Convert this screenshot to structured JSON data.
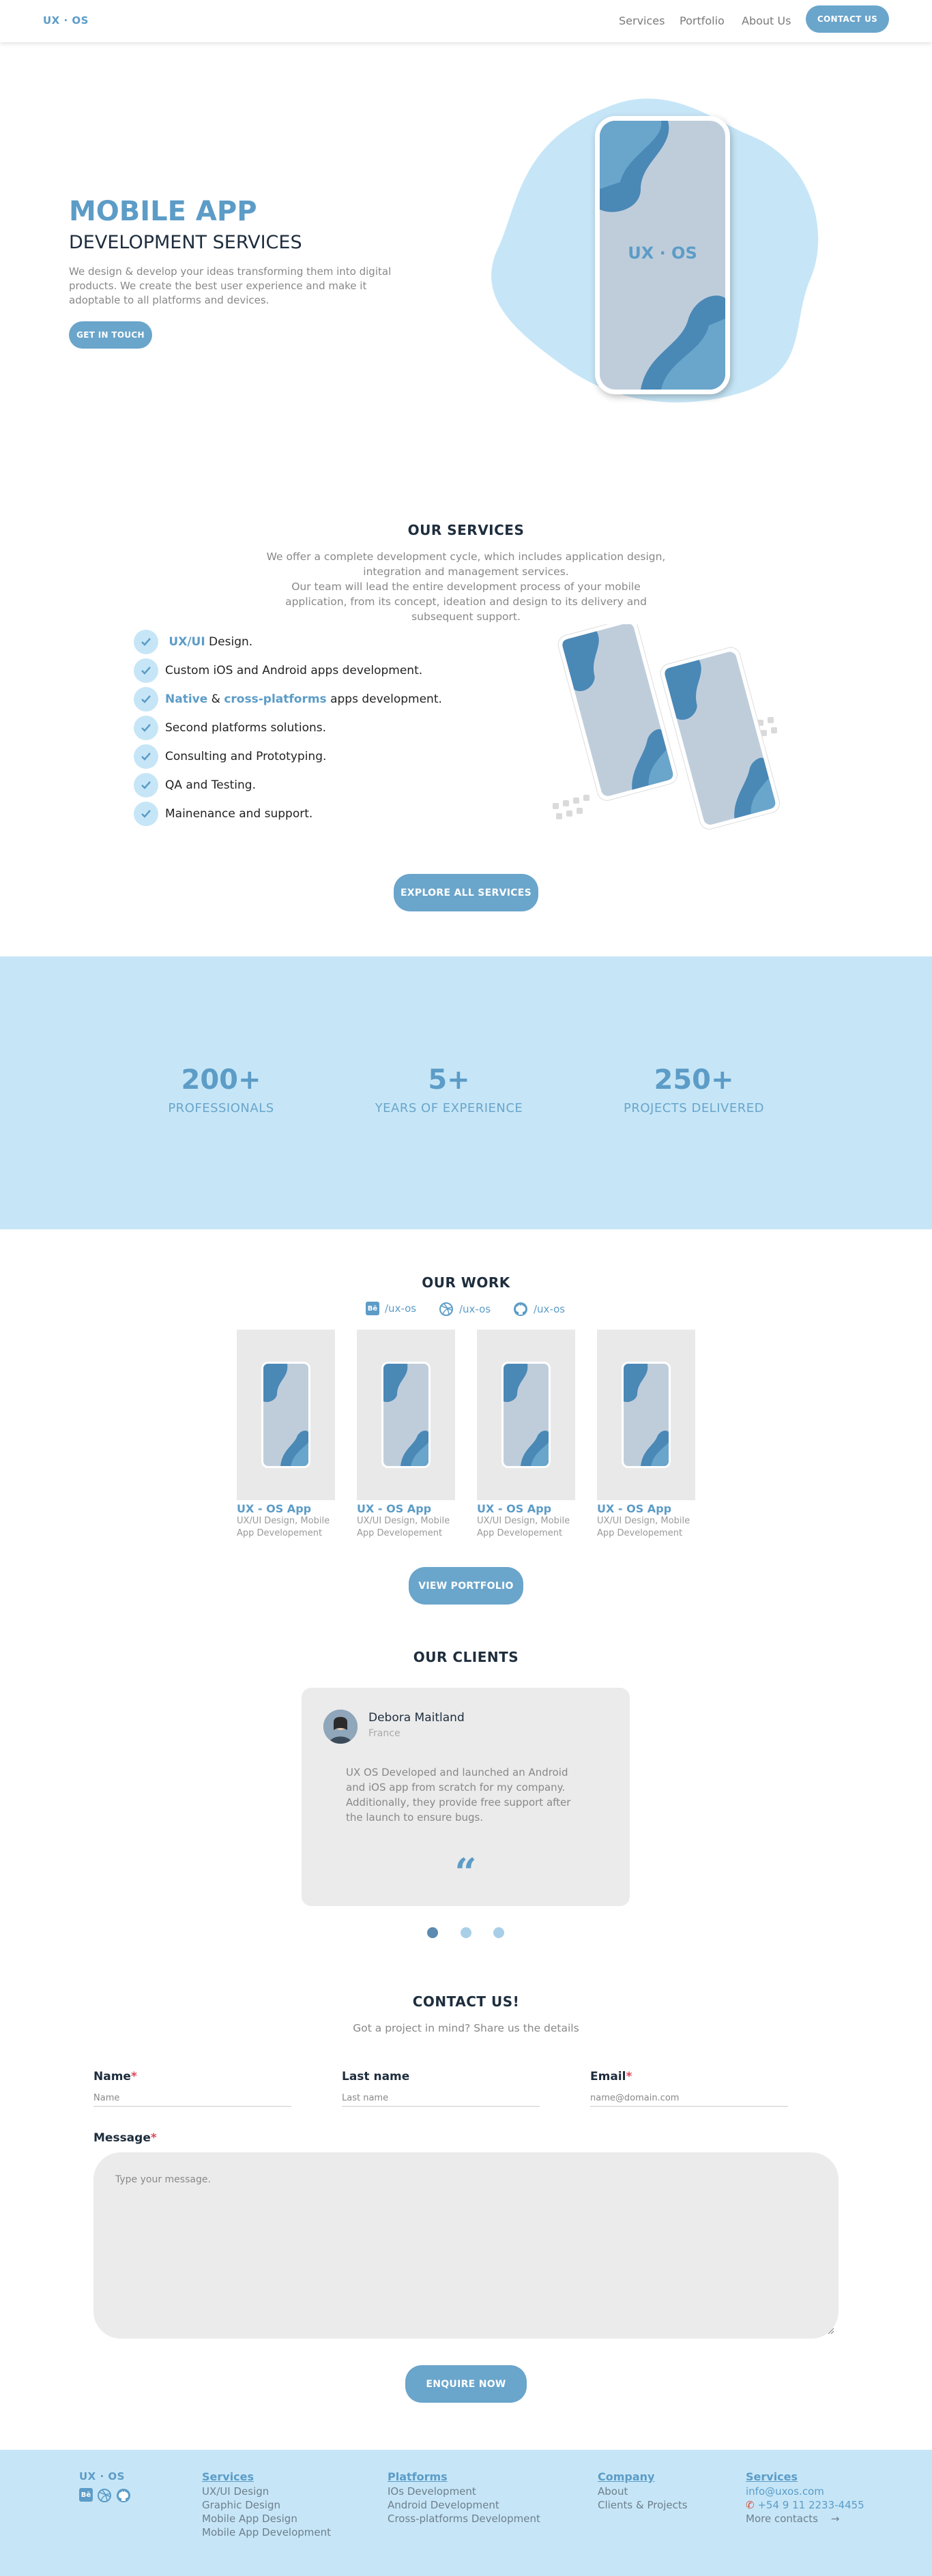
{
  "nav": {
    "logo": "UX · OS",
    "links": [
      "Services",
      "Portfolio",
      "About Us"
    ],
    "cta": "CONTACT US"
  },
  "hero": {
    "title": "MOBILE APP",
    "subtitle": "DEVELOPMENT SERVICES",
    "description": "We design & develop your ideas transforming them into digital products. We create the best user experience and make it adoptable to all platforms and devices.",
    "cta": "GET IN TOUCH",
    "phone_label": "UX · OS"
  },
  "services": {
    "title": "OUR SERVICES",
    "intro_1": "We offer a complete development cycle, which includes application design, integration and management services.",
    "intro_2": "Our team will lead the entire development process of your mobile application, from its concept, ideation and design to its delivery and subsequent support.",
    "items": [
      {
        "hl": "UX/UI",
        "text": " Design."
      },
      {
        "text": "Custom iOS and Android apps development."
      },
      {
        "hl": "Native",
        "mid": " & ",
        "hl2": "cross-platforms",
        "text": " apps development."
      },
      {
        "text": "Second platforms solutions."
      },
      {
        "text": "Consulting and Prototyping."
      },
      {
        "text": "QA and Testing."
      },
      {
        "text": "Mainenance and support."
      }
    ],
    "cta": "EXPLORE ALL SERVICES"
  },
  "stats": [
    {
      "value": "200+",
      "label": "PROFESSIONALS"
    },
    {
      "value": "5+",
      "label": "YEARS OF EXPERIENCE"
    },
    {
      "value": "250+",
      "label": "PROJECTS DELIVERED"
    }
  ],
  "work": {
    "title": "OUR WORK",
    "socials": [
      "/ux-os",
      "/ux-os",
      "/ux-os"
    ],
    "cards": [
      {
        "title": "UX - OS App",
        "sub": "UX/UI Design, Mobile App Developement"
      },
      {
        "title": "UX - OS App",
        "sub": "UX/UI Design, Mobile App Developement"
      },
      {
        "title": "UX - OS App",
        "sub": "UX/UI Design, Mobile App Developement"
      },
      {
        "title": "UX - OS App",
        "sub": "UX/UI Design, Mobile App Developement"
      }
    ],
    "cta": "VIEW PORTFOLIO"
  },
  "clients": {
    "title": "OUR CLIENTS",
    "name": "Debora Maitland",
    "country": "France",
    "quote": "UX OS Developed and launched an Android and iOS app from scratch for my company. Additionally, they provide free support after the launch to ensure bugs.",
    "quote_mark": "“"
  },
  "contact": {
    "title": "CONTACT US!",
    "subtitle": "Got a project in mind? Share us the details",
    "name_label": "Name",
    "name_ph": "Name",
    "last_label": "Last name",
    "last_ph": "Last name",
    "email_label": "Email",
    "email_ph": "name@domain.com",
    "message_label": "Message",
    "message_ph": "Type your message.",
    "required_mark": "*",
    "cta": "ENQUIRE NOW"
  },
  "footer": {
    "logo": "UX · OS",
    "col1": {
      "head": "Services",
      "items": [
        "UX/UI Design",
        "Graphic Design",
        "Mobile App Design",
        "Mobile App Development"
      ]
    },
    "col2": {
      "head": "Platforms",
      "items": [
        "IOs Development",
        "Android Development",
        "Cross-platforms Development"
      ]
    },
    "col3": {
      "head": "Company",
      "items": [
        "About",
        "Clients & Projects"
      ]
    },
    "col4": {
      "head": "Services",
      "email": "info@uxos.com",
      "phone": "+54 9 11 2233-4455",
      "more": "More contacts"
    }
  },
  "colors": {
    "accent": "#5c9cc7",
    "light": "#c6e6f7",
    "dark": "#1e2d3d"
  }
}
